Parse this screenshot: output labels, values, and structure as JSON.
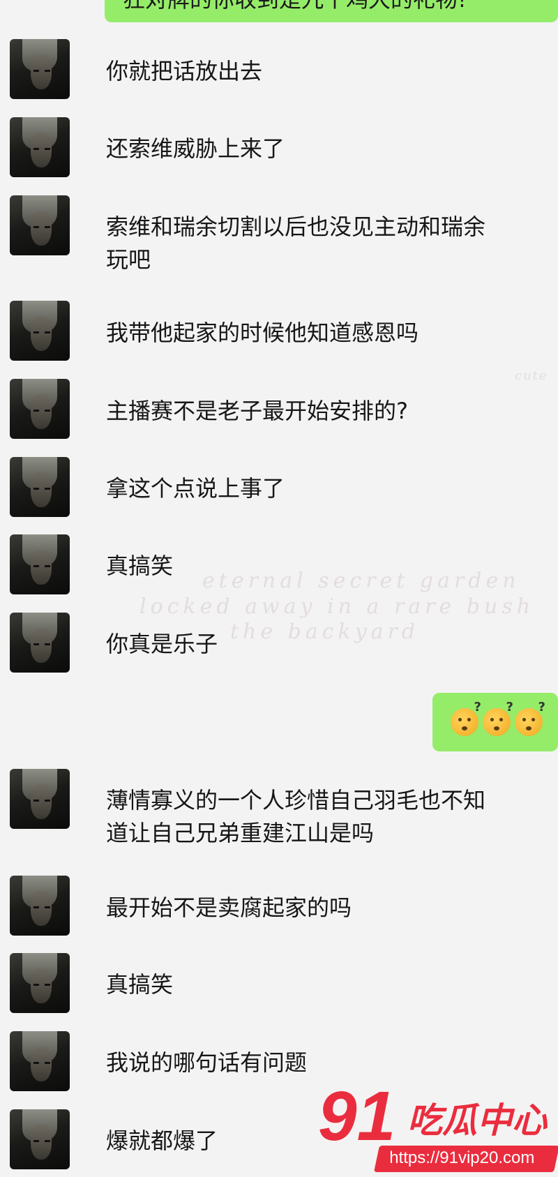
{
  "header_partial": {
    "text": "狂对牌的你收到是九个鸡大的礼物!"
  },
  "background_text": {
    "lines": [
      "eternal secret garden",
      "locked away in a rare bush",
      "the backyard"
    ],
    "cute": "cute"
  },
  "messages": [
    {
      "lines": [
        "你就把话放出去"
      ]
    },
    {
      "lines": [
        "还索维威胁上来了"
      ]
    },
    {
      "lines": [
        "索维和瑞余切割以后也没见主动和瑞余",
        "玩吧"
      ]
    },
    {
      "lines": [
        "我带他起家的时候他知道感恩吗"
      ]
    },
    {
      "lines": [
        "主播赛不是老子最开始安排的?"
      ]
    },
    {
      "lines": [
        "拿这个点说上事了"
      ]
    },
    {
      "lines": [
        "真搞笑"
      ]
    },
    {
      "lines": [
        "你真是乐子"
      ]
    },
    {
      "lines": [
        "薄情寡义的一个人珍惜自己羽毛也不知",
        "道让自己兄弟重建江山是吗"
      ]
    },
    {
      "lines": [
        "最开始不是卖腐起家的吗"
      ]
    },
    {
      "lines": [
        "真搞笑"
      ]
    },
    {
      "lines": [
        "我说的哪句话有问题"
      ]
    },
    {
      "lines": [
        "爆就都爆了"
      ]
    }
  ],
  "sent_message": {
    "emoji": [
      "thinking-question-emoji",
      "thinking-question-emoji",
      "thinking-question-emoji"
    ],
    "glyph": "?"
  },
  "watermark": {
    "number": "91",
    "name": "吃瓜中心",
    "url": "https://91vip20.com"
  },
  "colors": {
    "sent_bubble": "#95ec69",
    "watermark": "#ea2d3e",
    "background": "#f4f3f3"
  }
}
